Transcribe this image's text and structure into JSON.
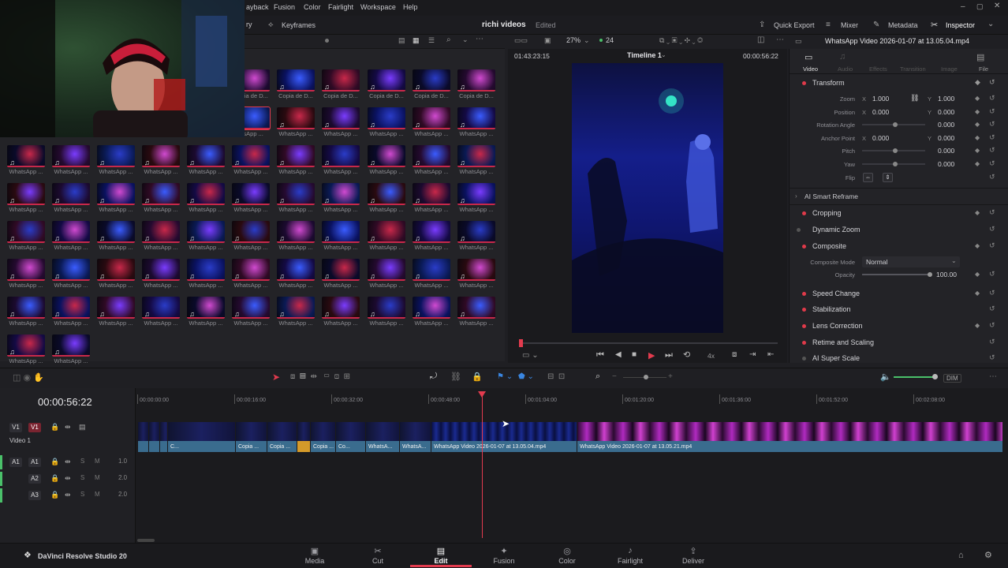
{
  "menu": {
    "items": [
      "ayback",
      "Fusion",
      "Color",
      "Fairlight",
      "Workspace",
      "Help"
    ]
  },
  "header": {
    "keyframes_label": "Keyframes",
    "project_name": "richi videos",
    "project_status": "Edited",
    "quick_export": "Quick Export",
    "mixer": "Mixer",
    "metadata": "Metadata",
    "inspector": "Inspector"
  },
  "viewer": {
    "zoom": "27%",
    "fps": "24",
    "timecode_left": "01:43:23:15",
    "timeline_name": "Timeline 1",
    "timecode_right": "00:00:56:22",
    "speed": "4x"
  },
  "media_pool": {
    "row1_labels": [
      "Copia de D...",
      "Copia de D...",
      "Copia de D...",
      "Copia de D...",
      "Copia de D..."
    ],
    "row2_first": "atsApp ...",
    "clip_label": "WhatsApp ..."
  },
  "inspector": {
    "clip_title": "WhatsApp Video 2026-01-07 at 13.05.04.mp4",
    "tabs": [
      "Video",
      "Audio",
      "Effects",
      "Transition",
      "Image",
      "File"
    ],
    "transform": "Transform",
    "zoom_label": "Zoom",
    "zoom_x": "1.000",
    "zoom_y": "1.000",
    "position_label": "Position",
    "pos_x": "0.000",
    "pos_y": "0.000",
    "rotation_label": "Rotation Angle",
    "rotation": "0.000",
    "anchor_label": "Anchor Point",
    "anchor_x": "0.000",
    "anchor_y": "0.000",
    "pitch_label": "Pitch",
    "pitch": "0.000",
    "yaw_label": "Yaw",
    "yaw": "0.000",
    "flip_label": "Flip",
    "x_axis": "X",
    "y_axis": "Y",
    "ai_smart_reframe": "AI Smart Reframe",
    "cropping": "Cropping",
    "dynamic_zoom": "Dynamic Zoom",
    "composite": "Composite",
    "composite_mode_label": "Composite Mode",
    "composite_mode": "Normal",
    "opacity_label": "Opacity",
    "opacity": "100.00",
    "speed_change": "Speed Change",
    "stabilization": "Stabilization",
    "lens_correction": "Lens Correction",
    "retime_scaling": "Retime and Scaling",
    "ai_super_scale": "AI Super Scale"
  },
  "timeline": {
    "current_tc": "00:00:56:22",
    "dim_label": "DIM",
    "ruler": [
      "00:00:00:00",
      "00:00:16:00",
      "00:00:32:00",
      "00:00:48:00",
      "00:01:04:00",
      "00:01:20:00",
      "00:01:36:00",
      "00:01:52:00",
      "00:02:08:00"
    ],
    "video_track": {
      "id": "V1",
      "name": "Video 1"
    },
    "audio_tracks": [
      {
        "id": "A1",
        "level": "1.0"
      },
      {
        "id": "A2",
        "level": "2.0"
      },
      {
        "id": "A3",
        "level": "2.0"
      }
    ],
    "solo": "S",
    "mute": "M",
    "clips": [
      "C...",
      "Copia ...",
      "Copia ...",
      "Copia ...",
      "Co...",
      "WhatsA...",
      "WhatsA...",
      "WhatsApp Video 2026-01-07 at 13.05.04.mp4",
      "WhatsApp Video 2026-01-07 at 13.05.21.mp4"
    ]
  },
  "app": {
    "name": "DaVinci Resolve Studio 20"
  },
  "pages": [
    "Media",
    "Cut",
    "Edit",
    "Fusion",
    "Color",
    "Fairlight",
    "Deliver"
  ],
  "colors": {
    "accent": "#e03a4a",
    "clip_blue": "#3a6c8e",
    "playhead": "#e23b4e"
  }
}
